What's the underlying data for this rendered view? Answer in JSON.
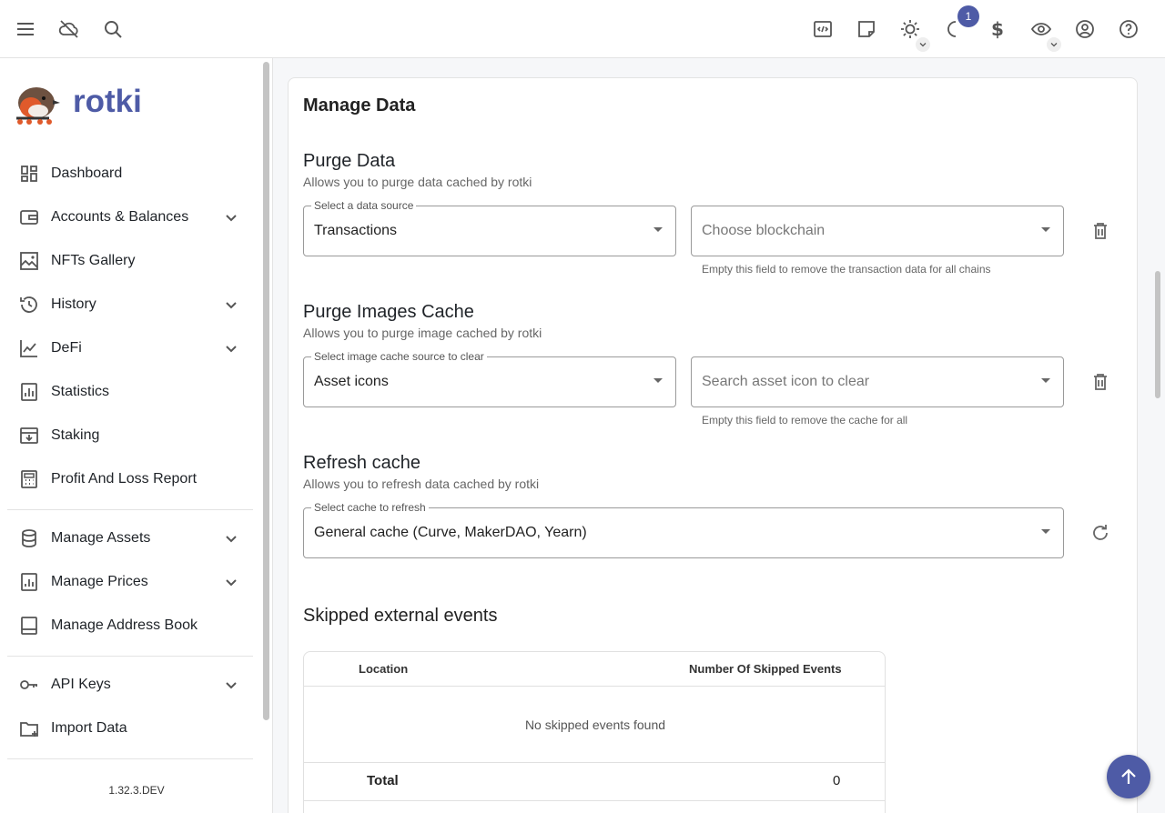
{
  "app": {
    "name": "rotki",
    "version": "1.32.3.DEV"
  },
  "topbar": {
    "notification_count": "1",
    "icons": [
      "menu-icon",
      "cloud-off-icon",
      "search-icon",
      "code-icon",
      "notes-icon",
      "theme-icon",
      "pending-icon",
      "currency-icon",
      "privacy-icon",
      "account-icon",
      "help-icon"
    ]
  },
  "sidebar": {
    "items": [
      {
        "label": "Dashboard"
      },
      {
        "label": "Accounts & Balances"
      },
      {
        "label": "NFTs Gallery"
      },
      {
        "label": "History"
      },
      {
        "label": "DeFi"
      },
      {
        "label": "Statistics"
      },
      {
        "label": "Staking"
      },
      {
        "label": "Profit And Loss Report"
      },
      {
        "label": "Manage Assets"
      },
      {
        "label": "Manage Prices"
      },
      {
        "label": "Manage Address Book"
      },
      {
        "label": "API Keys"
      },
      {
        "label": "Import Data"
      }
    ]
  },
  "main": {
    "title": "Manage Data",
    "purge_data": {
      "title": "Purge Data",
      "subtitle": "Allows you to purge data cached by rotki",
      "source_label": "Select a data source",
      "source_value": "Transactions",
      "chain_placeholder": "Choose blockchain",
      "hint": "Empty this field to remove the transaction data for all chains"
    },
    "purge_images": {
      "title": "Purge Images Cache",
      "subtitle": "Allows you to purge image cached by rotki",
      "source_label": "Select image cache source to clear",
      "source_value": "Asset icons",
      "search_placeholder": "Search asset icon to clear",
      "hint": "Empty this field to remove the cache for all"
    },
    "refresh_cache": {
      "title": "Refresh cache",
      "subtitle": "Allows you to refresh data cached by rotki",
      "label": "Select cache to refresh",
      "value": "General cache (Curve, MakerDAO, Yearn)"
    },
    "skipped": {
      "title": "Skipped external events",
      "columns": [
        "Location",
        "Number Of Skipped Events"
      ],
      "empty": "No skipped events found",
      "total_label": "Total",
      "total_value": "0"
    }
  },
  "colors": {
    "accent": "#4e5ba6"
  }
}
